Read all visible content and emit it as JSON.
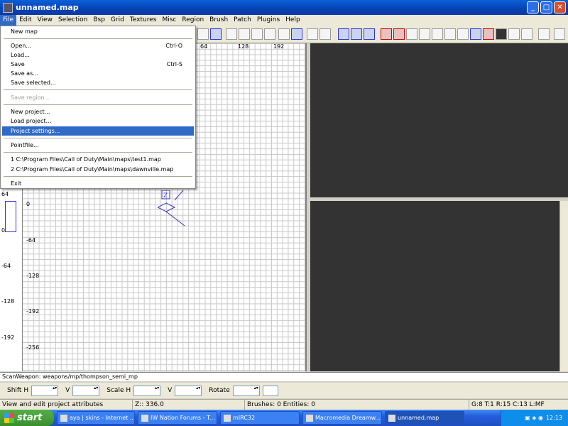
{
  "window": {
    "title": "unnamed.map"
  },
  "menubar": [
    "File",
    "Edit",
    "View",
    "Selection",
    "Bsp",
    "Grid",
    "Textures",
    "Misc",
    "Region",
    "Brush",
    "Patch",
    "Plugins",
    "Help"
  ],
  "file_menu": {
    "items": [
      {
        "label": "New map"
      },
      {
        "label": "Open...",
        "shortcut": "Ctrl-O"
      },
      {
        "label": "Load..."
      },
      {
        "label": "Save",
        "shortcut": "Ctrl-S"
      },
      {
        "label": "Save as..."
      },
      {
        "label": "Save selected..."
      },
      {
        "label": "Save region..."
      },
      {
        "label": "New project..."
      },
      {
        "label": "Load project..."
      },
      {
        "label": "Project settings..."
      },
      {
        "label": "Pointfile..."
      },
      {
        "label": "1 C:\\Program Files\\Call of Duty\\Main\\maps\\test1.map"
      },
      {
        "label": "2 C:\\Program Files\\Call of Duty\\Main\\maps\\dawnville.map"
      },
      {
        "label": "Exit"
      }
    ]
  },
  "grid": {
    "top_ticks": [
      "64",
      "128",
      "192"
    ],
    "left_ticks": [
      "0",
      "-64",
      "-128",
      "-192",
      "-256"
    ],
    "side_ticks": [
      "64",
      "0",
      "-64",
      "-128",
      "-192"
    ]
  },
  "console": {
    "text": "ScanWeapon: weapons/mp/thompson_semi_mp"
  },
  "surface": {
    "shift_h": "Shift H",
    "v1": "V",
    "scale_h": "Scale H",
    "v2": "V",
    "rotate": "Rotate"
  },
  "statusbar": {
    "help": "View and edit project attributes",
    "z": "Z:: 336.0",
    "counts": "Brushes: 0 Entities: 0",
    "grid": "G:8 T:1 R:15 C:13 L:MF"
  },
  "taskbar": {
    "start": "start",
    "tasks": [
      "aya | skins - Internet ...",
      "IW Nation Forums - T...",
      "mIRC32",
      "Macromedia Dreamw...",
      "unnamed.map"
    ],
    "clock": "12:13"
  }
}
